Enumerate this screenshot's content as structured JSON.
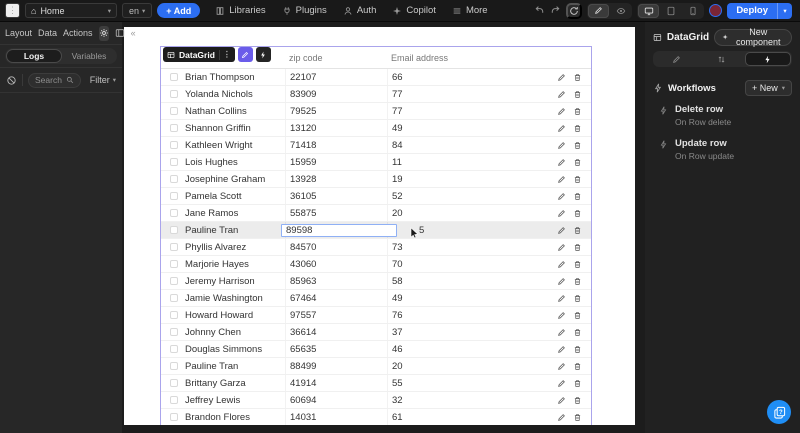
{
  "topbar": {
    "home": {
      "label": "Home"
    },
    "locale": "en",
    "add_label": "+ Add",
    "nav": [
      {
        "label": "Libraries"
      },
      {
        "label": "Plugins"
      },
      {
        "label": "Auth"
      },
      {
        "label": "Copilot"
      },
      {
        "label": "More"
      }
    ],
    "deploy_label": "Deploy"
  },
  "left_panel": {
    "tabs": [
      {
        "label": "Layout"
      },
      {
        "label": "Data"
      },
      {
        "label": "Actions"
      }
    ],
    "toggle": [
      {
        "label": "Logs"
      },
      {
        "label": "Variables"
      }
    ],
    "search_placeholder": "Search",
    "filter_label": "Filter"
  },
  "canvas": {
    "component": {
      "name": "DataGrid"
    },
    "table": {
      "columns": [
        {
          "label": ""
        },
        {
          "label": "zip code"
        },
        {
          "label": "Email address"
        }
      ],
      "rows": [
        {
          "name": "Brian Thompson",
          "zip": "22107",
          "email": "66"
        },
        {
          "name": "Yolanda Nichols",
          "zip": "83909",
          "email": "77"
        },
        {
          "name": "Nathan Collins",
          "zip": "79525",
          "email": "77"
        },
        {
          "name": "Shannon Griffin",
          "zip": "13120",
          "email": "49"
        },
        {
          "name": "Kathleen Wright",
          "zip": "71418",
          "email": "84"
        },
        {
          "name": "Lois Hughes",
          "zip": "15959",
          "email": "11"
        },
        {
          "name": "Josephine Graham",
          "zip": "13928",
          "email": "19"
        },
        {
          "name": "Pamela Scott",
          "zip": "36105",
          "email": "52"
        },
        {
          "name": "Jane Ramos",
          "zip": "55875",
          "email": "20"
        },
        {
          "name": "Pauline Tran",
          "zip": "89598",
          "email": "5"
        },
        {
          "name": "Phyllis Alvarez",
          "zip": "84570",
          "email": "73"
        },
        {
          "name": "Marjorie Hayes",
          "zip": "43060",
          "email": "70"
        },
        {
          "name": "Jeremy Harrison",
          "zip": "85963",
          "email": "58"
        },
        {
          "name": "Jamie Washington",
          "zip": "67464",
          "email": "49"
        },
        {
          "name": "Howard Howard",
          "zip": "97557",
          "email": "76"
        },
        {
          "name": "Johnny Chen",
          "zip": "36614",
          "email": "37"
        },
        {
          "name": "Douglas Simmons",
          "zip": "65635",
          "email": "46"
        },
        {
          "name": "Pauline Tran",
          "zip": "88499",
          "email": "20"
        },
        {
          "name": "Brittany Garza",
          "zip": "41914",
          "email": "55"
        },
        {
          "name": "Jeffrey Lewis",
          "zip": "60694",
          "email": "32"
        },
        {
          "name": "Brandon Flores",
          "zip": "14031",
          "email": "61"
        }
      ],
      "editing": {
        "row_index": 9,
        "zip_value": "89598",
        "email_value": "5"
      }
    }
  },
  "right_panel": {
    "title": "DataGrid",
    "new_component_label": "New component",
    "workflows": {
      "title": "Workflows",
      "new_label": "+ New",
      "items": [
        {
          "title": "Delete row",
          "subtitle": "On Row delete"
        },
        {
          "title": "Update row",
          "subtitle": "On Row update"
        }
      ]
    }
  },
  "colors": {
    "accent_blue": "#2c6ef2",
    "component_purple": "#6a5cea",
    "selection_outline": "#aaa4ec",
    "help_blue": "#1f8ef5",
    "avatar_maroon": "#7a2535"
  }
}
